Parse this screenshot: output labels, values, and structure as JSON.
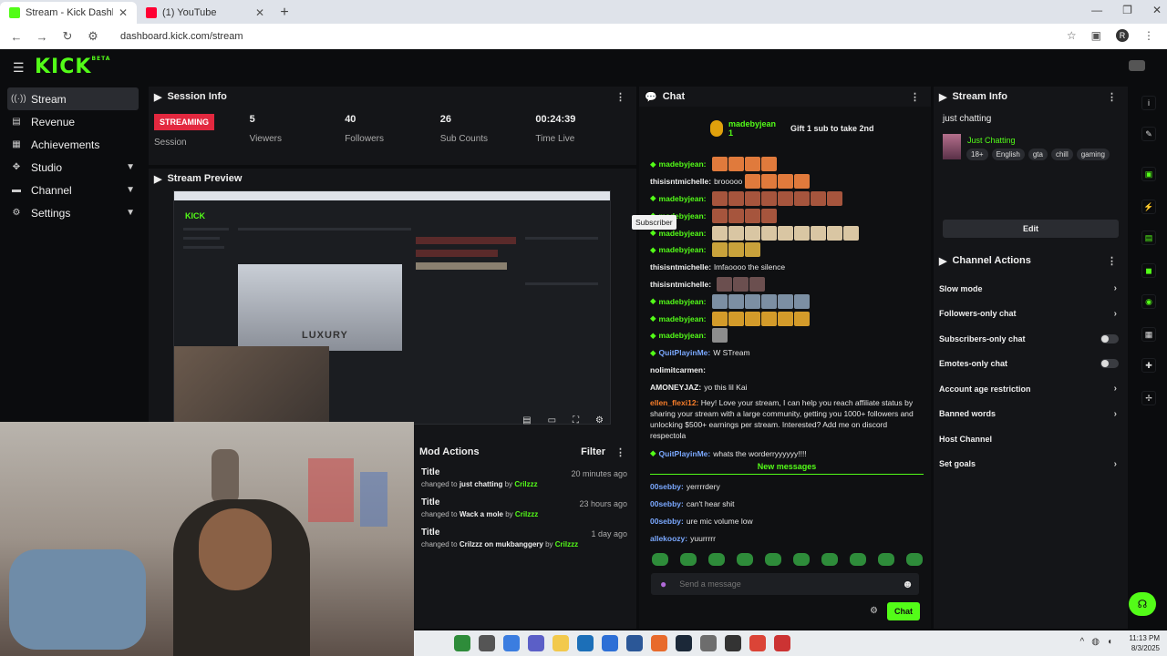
{
  "browser": {
    "tabs": [
      {
        "title": "Stream - Kick Dashboard",
        "fav": "#53fc18"
      },
      {
        "title": "(1) YouTube",
        "fav": "#ff0033"
      }
    ],
    "url": "dashboard.kick.com/stream",
    "profile_letter": "R"
  },
  "kick": {
    "logo": "KICK",
    "logo_sub": "BETA"
  },
  "sidebar": {
    "items": [
      {
        "label": "Stream",
        "icon": "stream-icon"
      },
      {
        "label": "Revenue",
        "icon": "revenue-icon"
      },
      {
        "label": "Achievements",
        "icon": "achievements-icon"
      },
      {
        "label": "Studio",
        "icon": "studio-icon"
      },
      {
        "label": "Channel",
        "icon": "channel-icon"
      },
      {
        "label": "Settings",
        "icon": "settings-icon"
      }
    ]
  },
  "session": {
    "title": "Session Info",
    "status": "STREAMING",
    "status_label": "Session",
    "stats": [
      {
        "value": "5",
        "label": "Viewers"
      },
      {
        "value": "40",
        "label": "Followers"
      },
      {
        "value": "26",
        "label": "Sub Counts"
      },
      {
        "value": "00:24:39",
        "label": "Time Live"
      }
    ]
  },
  "preview": {
    "title": "Stream Preview",
    "mini_text": "LUXURY",
    "mini_logo": "KICK"
  },
  "mod_actions": {
    "title": "Mod Actions",
    "filter": "Filter",
    "items": [
      {
        "title": "Title",
        "ago": "20 minutes ago",
        "prefix": "changed to",
        "value": "just chatting",
        "by": "by",
        "user": "Crilzzz"
      },
      {
        "title": "Title",
        "ago": "23 hours ago",
        "prefix": "changed to",
        "value": "Wack a mole",
        "by": "by",
        "user": "Crilzzz"
      },
      {
        "title": "Title",
        "ago": "1 day ago",
        "prefix": "changed to",
        "value": "Crilzzz on mukbanggery",
        "by": "by",
        "user": "Crilzzz"
      }
    ]
  },
  "chat": {
    "title": "Chat",
    "pinned": {
      "name": "madebyjean",
      "count": "1",
      "text": "Gift 1 sub to take 2nd"
    },
    "messages": [
      {
        "user": "madebyjean:",
        "color": "#53fc18",
        "text": "",
        "emotes": 4,
        "emote_color": "#e07a3c"
      },
      {
        "user": "thisisntmichelle:",
        "color": "#eeeeee",
        "text": "brooooo",
        "emotes": 4,
        "emote_color": "#e07a3c"
      },
      {
        "user": "madebyjean:",
        "color": "#53fc18",
        "text": "",
        "emotes": 8,
        "emote_color": "#a6553d"
      },
      {
        "user": "madebyjean:",
        "color": "#53fc18",
        "text": "",
        "emotes": 4,
        "emote_color": "#a6553d"
      },
      {
        "user": "madebyjean:",
        "color": "#53fc18",
        "text": "",
        "emotes": 9,
        "emote_color": "#d9c6a3"
      },
      {
        "user": "madebyjean:",
        "color": "#53fc18",
        "text": "",
        "emotes": 3,
        "emote_color": "#c9a23b"
      },
      {
        "user": "thisisntmichelle:",
        "color": "#eeeeee",
        "text": "lmfaoooo the silence",
        "emotes": 0,
        "emote_color": ""
      },
      {
        "user": "thisisntmichelle:",
        "color": "#eeeeee",
        "text": "",
        "emotes": 3,
        "emote_color": "#6b4f4f"
      },
      {
        "user": "madebyjean:",
        "color": "#53fc18",
        "text": "",
        "emotes": 6,
        "emote_color": "#7c8fa3"
      },
      {
        "user": "madebyjean:",
        "color": "#53fc18",
        "text": "",
        "emotes": 6,
        "emote_color": "#d39b2a"
      },
      {
        "user": "madebyjean:",
        "color": "#53fc18",
        "text": "",
        "emotes": 1,
        "emote_color": "#8d8d8d"
      },
      {
        "user": "QuitPlayinMe:",
        "color": "#7aa8ff",
        "text": "W STream",
        "emotes": 0,
        "emote_color": ""
      },
      {
        "user": "nolimitcarmen:",
        "color": "#eeeeee",
        "text": "",
        "emotes": 0,
        "emote_color": ""
      },
      {
        "user": "AMONEYJAZ:",
        "color": "#eeeeee",
        "text": "yo this lil Kai",
        "emotes": 0,
        "emote_color": ""
      }
    ],
    "long_msg": {
      "user": "ellen_flexi12:",
      "text": "Hey! Love your stream, I can help you reach affiliate status by sharing your stream with a large community, getting you 1000+ followers and unlocking $500+ earnings per stream. Interested? Add me on discord respectola"
    },
    "after_long": {
      "user": "QuitPlayinMe:",
      "text": "whats the worderryyyyyy!!!!"
    },
    "tooltip": "Subscriber",
    "new_label": "New messages",
    "new_messages": [
      {
        "user": "00sebby:",
        "text": "yerrrrdery"
      },
      {
        "user": "00sebby:",
        "text": "can't hear shit"
      },
      {
        "user": "00sebby:",
        "text": "ure mic volume low"
      },
      {
        "user": "allekoozy:",
        "text": "yuurrrrr"
      }
    ],
    "input_placeholder": "Send a message",
    "send_label": "Chat"
  },
  "stream_info": {
    "title": "Stream Info",
    "stream_title": "just chatting",
    "category": "Just Chatting",
    "tags": [
      "18+",
      "English",
      "gta",
      "chill",
      "gaming"
    ],
    "edit_label": "Edit"
  },
  "channel_actions": {
    "title": "Channel Actions",
    "items": [
      {
        "label": "Slow mode",
        "kind": "chevron"
      },
      {
        "label": "Followers-only chat",
        "kind": "chevron"
      },
      {
        "label": "Subscribers-only chat",
        "kind": "toggle"
      },
      {
        "label": "Emotes-only chat",
        "kind": "toggle"
      },
      {
        "label": "Account age restriction",
        "kind": "chevron"
      },
      {
        "label": "Banned words",
        "kind": "chevron"
      },
      {
        "label": "Host Channel",
        "kind": "none"
      },
      {
        "label": "Set goals",
        "kind": "chevron"
      }
    ]
  },
  "taskbar": {
    "time": "11:13 PM",
    "date": "8/3/2025"
  }
}
